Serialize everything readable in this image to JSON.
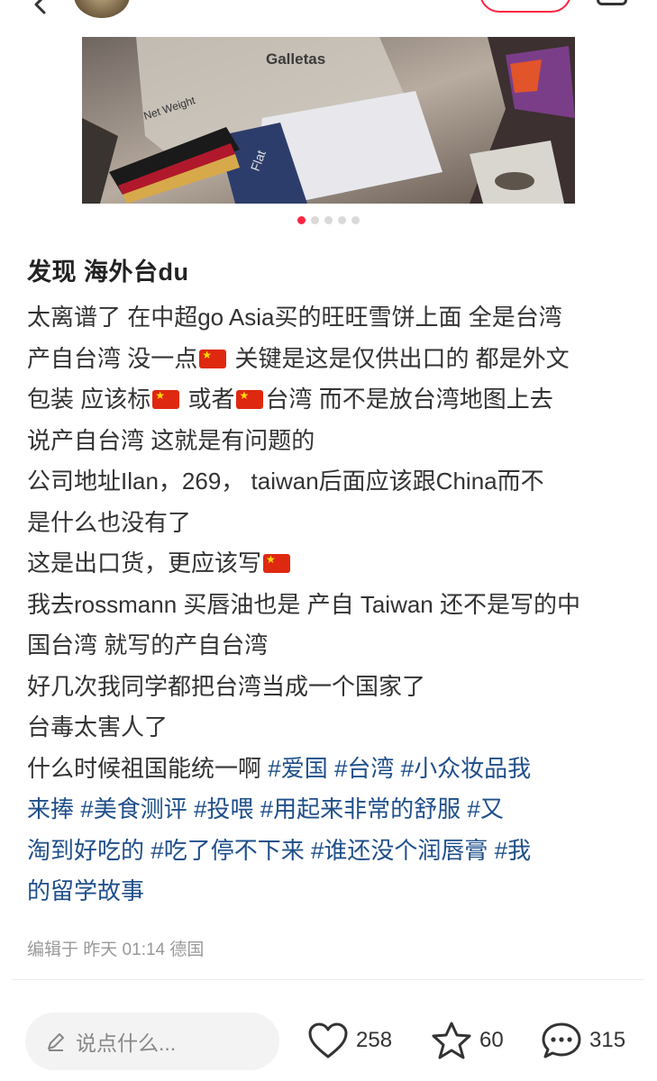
{
  "header": {
    "back_icon": "chevron-left-icon",
    "share_icon": "share-icon"
  },
  "carousel": {
    "image_visible_text": "Galletas",
    "image_visible_text_2": "Net Weight",
    "image_visible_text_3": "Flat",
    "total_slides": 5,
    "active_index": 0
  },
  "post": {
    "title": "发现 海外台du",
    "lines": [
      [
        "太离谱了 在中超go Asia买的旺旺雪饼上面 全是台湾"
      ],
      [
        "产自台湾 没一点",
        "FLAG",
        " 关键是这是仅供出口的 都是外文"
      ],
      [
        "包装 应该标",
        "FLAG",
        " 或者",
        "FLAG",
        "台湾 而不是放台湾地图上去"
      ],
      [
        "说产自台湾  这就是有问题的"
      ],
      [
        "公司地址Ilan，269，  taiwan后面应该跟China而不"
      ],
      [
        "是什么也没有了"
      ],
      [
        "这是出口货，更应该写",
        "FLAG"
      ],
      [
        "我去rossmann 买唇油也是 产自 Taiwan 还不是写的中"
      ],
      [
        "国台湾 就写的产自台湾"
      ],
      [
        "好几次我同学都把台湾当成一个国家了"
      ],
      [
        "台毒太害人了"
      ]
    ],
    "last_line_text": "什么时候祖国能统一啊 ",
    "tag_lines": [
      [
        "#爱国",
        "#台湾",
        "#小众妆品我"
      ],
      [
        "来捧",
        "#美食测评",
        "#投喂",
        "#用起来非常的舒服",
        "#又"
      ],
      [
        "淘到好吃的",
        "#吃了停不下来",
        "#谁还没个润唇膏",
        "#我"
      ],
      [
        "的留学故事"
      ]
    ],
    "meta": "编辑于 昨天 01:14 德国",
    "flag_icon": "china-flag-icon"
  },
  "bottom_bar": {
    "comment_placeholder": "说点什么...",
    "likes": "258",
    "collects": "60",
    "comments": "315"
  },
  "colors": {
    "accent": "#ff2442",
    "tag": "#1f4f8a",
    "flag": "#de2910"
  }
}
